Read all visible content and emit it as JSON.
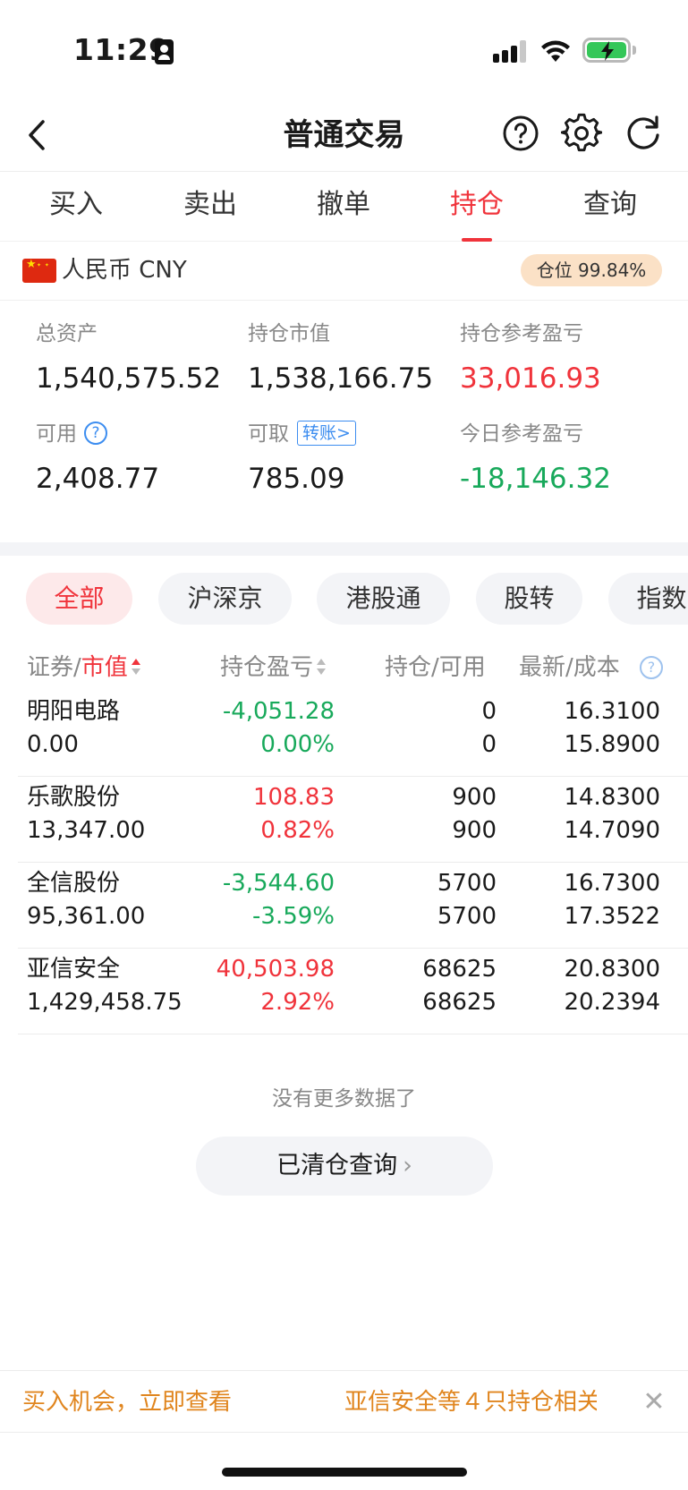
{
  "status": {
    "time": "11:29"
  },
  "nav": {
    "title": "普通交易"
  },
  "tabs": [
    {
      "label": "买入",
      "active": false
    },
    {
      "label": "卖出",
      "active": false
    },
    {
      "label": "撤单",
      "active": false
    },
    {
      "label": "持仓",
      "active": true
    },
    {
      "label": "查询",
      "active": false
    }
  ],
  "currency": {
    "label": "人民币 CNY",
    "position_badge": "仓位 99.84%"
  },
  "assets": {
    "total_assets": {
      "label": "总资产",
      "value": "1,540,575.52"
    },
    "holding_value": {
      "label": "持仓市值",
      "value": "1,538,166.75"
    },
    "holding_pnl": {
      "label": "持仓参考盈亏",
      "value": "33,016.93"
    },
    "available": {
      "label": "可用",
      "value": "2,408.77"
    },
    "withdrawable": {
      "label": "可取",
      "value": "785.09",
      "transfer_link": "转账>"
    },
    "today_pnl": {
      "label": "今日参考盈亏",
      "value": "-18,146.32"
    }
  },
  "filters": [
    {
      "label": "全部",
      "active": true
    },
    {
      "label": "沪深京",
      "active": false
    },
    {
      "label": "港股通",
      "active": false
    },
    {
      "label": "股转",
      "active": false
    },
    {
      "label": "指数",
      "active": false
    }
  ],
  "table": {
    "col_security": "证券",
    "col_market_value": "市值",
    "col_pnl": "持仓盈亏",
    "col_holding": "持仓",
    "col_available": "可用",
    "col_latest": "最新",
    "col_cost": "成本",
    "separator": "/",
    "rows": [
      {
        "name": "明阳电路",
        "market_value": "0.00",
        "pnl": "-4,051.28",
        "pnl_pct": "0.00%",
        "pnl_sign": "negative",
        "pct_sign": "negative",
        "holding": "0",
        "available": "0",
        "latest": "16.3100",
        "cost": "15.8900"
      },
      {
        "name": "乐歌股份",
        "market_value": "13,347.00",
        "pnl": "108.83",
        "pnl_pct": "0.82%",
        "pnl_sign": "positive",
        "pct_sign": "positive",
        "holding": "900",
        "available": "900",
        "latest": "14.8300",
        "cost": "14.7090"
      },
      {
        "name": "全信股份",
        "market_value": "95,361.00",
        "pnl": "-3,544.60",
        "pnl_pct": "-3.59%",
        "pnl_sign": "negative",
        "pct_sign": "negative",
        "holding": "5700",
        "available": "5700",
        "latest": "16.7300",
        "cost": "17.3522"
      },
      {
        "name": "亚信安全",
        "market_value": "1,429,458.75",
        "pnl": "40,503.98",
        "pnl_pct": "2.92%",
        "pnl_sign": "positive",
        "pct_sign": "positive",
        "holding": "68625",
        "available": "68625",
        "latest": "20.8300",
        "cost": "20.2394"
      }
    ]
  },
  "footer": {
    "no_more": "没有更多数据了",
    "cleared_query": "已清仓查询",
    "cleared_chevron": "›"
  },
  "banner": {
    "left_text": "买入机会，立即查看",
    "right_text": "亚信安全等４只持仓相关",
    "close_glyph": "✕"
  },
  "colors": {
    "accent_red": "#f0333b",
    "gain_red": "#f0333b",
    "loss_green": "#18a95b",
    "link_blue": "#3c8df0",
    "banner_orange": "#e0851e",
    "badge_bg": "#fbe1c6"
  }
}
